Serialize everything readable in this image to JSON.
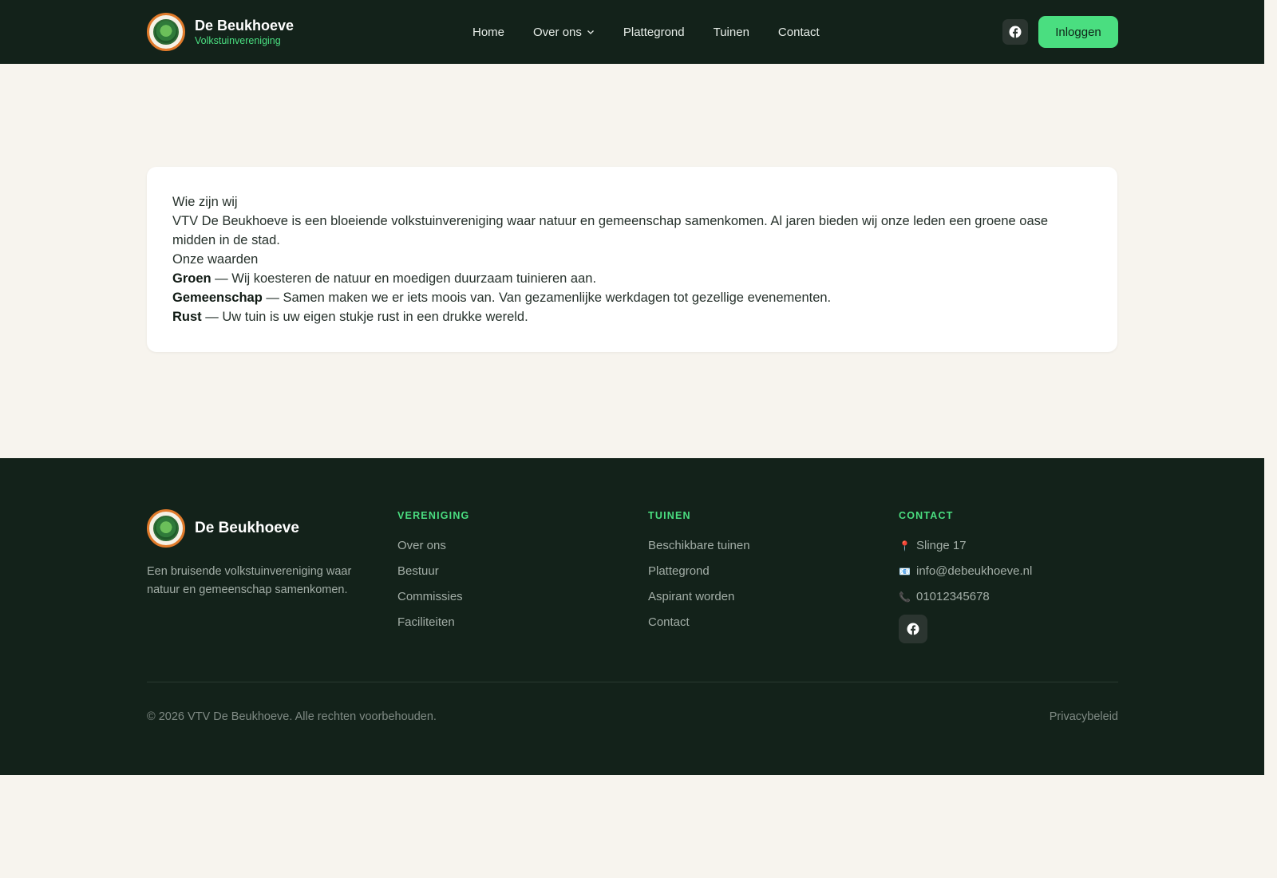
{
  "header": {
    "brand_name": "De Beukhoeve",
    "brand_sub": "Volkstuinvereniging",
    "nav": [
      {
        "label": "Home"
      },
      {
        "label": "Over ons",
        "has_dropdown": true
      },
      {
        "label": "Plattegrond"
      },
      {
        "label": "Tuinen"
      },
      {
        "label": "Contact"
      }
    ],
    "facebook_icon": "facebook-icon",
    "login_label": "Inloggen"
  },
  "content": {
    "heading_about": "Wie zijn wij",
    "about_text": "VTV De Beukhoeve is een bloeiende volkstuinvereniging waar natuur en gemeenschap samenkomen. Al jaren bieden wij onze leden een groene oase midden in de stad.",
    "heading_values": "Onze waarden",
    "values": [
      {
        "term": "Groen",
        "text": " — Wij koesteren de natuur en moedigen duurzaam tuinieren aan."
      },
      {
        "term": "Gemeenschap",
        "text": " — Samen maken we er iets moois van. Van gezamenlijke werkdagen tot gezellige evenementen."
      },
      {
        "term": "Rust",
        "text": " — Uw tuin is uw eigen stukje rust in een drukke wereld."
      }
    ]
  },
  "footer": {
    "brand_name": "De Beukhoeve",
    "description": "Een bruisende volkstuinvereniging waar natuur en gemeenschap samenkomen.",
    "columns": [
      {
        "title": "VERENIGING",
        "links": [
          "Over ons",
          "Bestuur",
          "Commissies",
          "Faciliteiten"
        ]
      },
      {
        "title": "TUINEN",
        "links": [
          "Beschikbare tuinen",
          "Plattegrond",
          "Aspirant worden",
          "Contact"
        ]
      }
    ],
    "contact": {
      "title": "CONTACT",
      "address": "Slinge 17",
      "email": "info@debeukhoeve.nl",
      "phone": "01012345678"
    },
    "copyright": "© 2026 VTV De Beukhoeve. Alle rechten voorbehouden.",
    "privacy": "Privacybeleid"
  },
  "colors": {
    "header_bg": "#13221a",
    "accent": "#4ade80",
    "page_bg": "#f7f4ee",
    "logo_ring": "#e07a2a"
  }
}
